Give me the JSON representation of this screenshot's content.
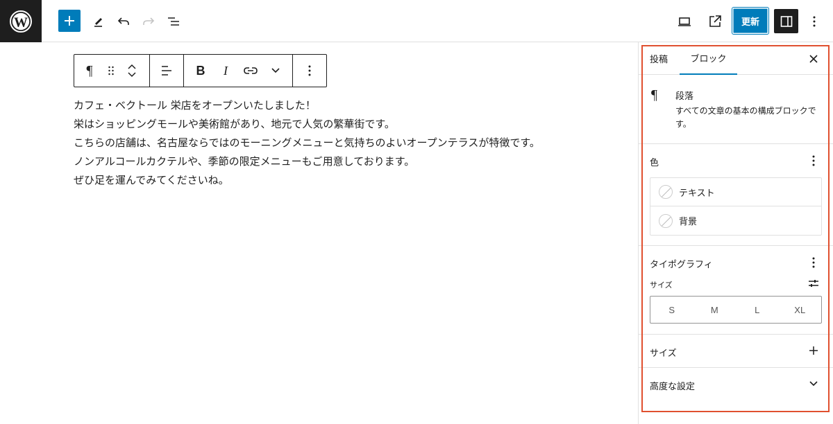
{
  "toolbar": {
    "update_label": "更新",
    "icons": [
      "wordpress-icon",
      "plus-icon",
      "pencil-icon",
      "undo-icon",
      "redo-icon",
      "list-view-icon",
      "desktop-icon",
      "external-link-icon",
      "settings-icon",
      "kebab-icon"
    ]
  },
  "block_toolbar": {
    "paragraph_glyph": "¶",
    "bold_label": "B",
    "italic_label": "I"
  },
  "content": {
    "lines": [
      "カフェ・ベクトール 栄店をオープンいたしました！",
      "栄はショッピングモールや美術館があり、地元で人気の繁華街です。",
      "こちらの店舗は、名古屋ならではのモーニングメニューと気持ちのよいオープンテラスが特徴です。",
      "ノンアルコールカクテルや、季節の限定メニューもご用意しております。",
      "ぜひ足を運んでみてくださいね。"
    ]
  },
  "sidebar": {
    "tabs": {
      "post": "投稿",
      "block": "ブロック"
    },
    "block_card": {
      "icon_glyph": "¶",
      "title": "段落",
      "description": "すべての文章の基本の構成ブロックです。"
    },
    "color": {
      "title": "色",
      "items": [
        "テキスト",
        "背景"
      ]
    },
    "typography": {
      "title": "タイポグラフィ",
      "size_label": "サイズ",
      "sizes": [
        "S",
        "M",
        "L",
        "XL"
      ]
    },
    "size_section": {
      "title": "サイズ"
    },
    "advanced": {
      "title": "高度な設定"
    }
  },
  "colors": {
    "accent": "#007cba",
    "highlight": "#e0502f",
    "dark": "#1e1e1e"
  }
}
